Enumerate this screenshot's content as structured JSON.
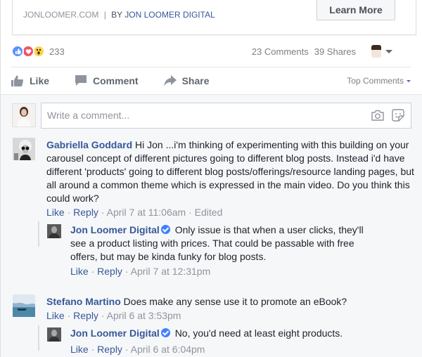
{
  "link_preview": {
    "domain": "JONLOOMER.COM",
    "separator": "|",
    "by_label": "BY",
    "brand": "JON LOOMER DIGITAL",
    "cta_label": "Learn More"
  },
  "reactions": {
    "types": [
      "like",
      "love",
      "wow"
    ],
    "count": "233",
    "comments_label": "23 Comments",
    "shares_label": "39 Shares"
  },
  "actions": {
    "like": "Like",
    "comment": "Comment",
    "share": "Share",
    "sort_label": "Top Comments"
  },
  "composer": {
    "placeholder": "Write a comment...",
    "camera_icon": "camera-icon",
    "sticker_icon": "sticker-icon"
  },
  "comments": [
    {
      "author": "Gabriella Goddard",
      "text": "Hi Jon ...i'm thinking of experimenting with this building on your carousel concept of different pictures going to different blog posts. Instead i'd have different 'products' going to different blog posts/offerings/resource landing pages, but all around a common theme which is expressed in the main video. Do you think this could work?",
      "like_label": "Like",
      "reply_label": "Reply",
      "time": "April 7 at 11:06am",
      "edited": "Edited",
      "replies": [
        {
          "author": "Jon Loomer Digital",
          "verified": true,
          "text": "Only issue is that when a user clicks, they'll see a product listing with prices. That could be passable with free offers, but may be kinda funky for blog posts.",
          "like_label": "Like",
          "reply_label": "Reply",
          "time": "April 7 at 12:31pm"
        }
      ]
    },
    {
      "author": "Stefano Martino",
      "text": "Does make any sense use it to promote an eBook?",
      "like_label": "Like",
      "reply_label": "Reply",
      "time": "April 6 at 3:53pm",
      "replies": [
        {
          "author": "Jon Loomer Digital",
          "verified": true,
          "text": "No, you'd need at least eight products.",
          "like_label": "Like",
          "reply_label": "Reply",
          "time": "April 6 at 6:04pm"
        }
      ]
    }
  ],
  "separator_dot": "·"
}
